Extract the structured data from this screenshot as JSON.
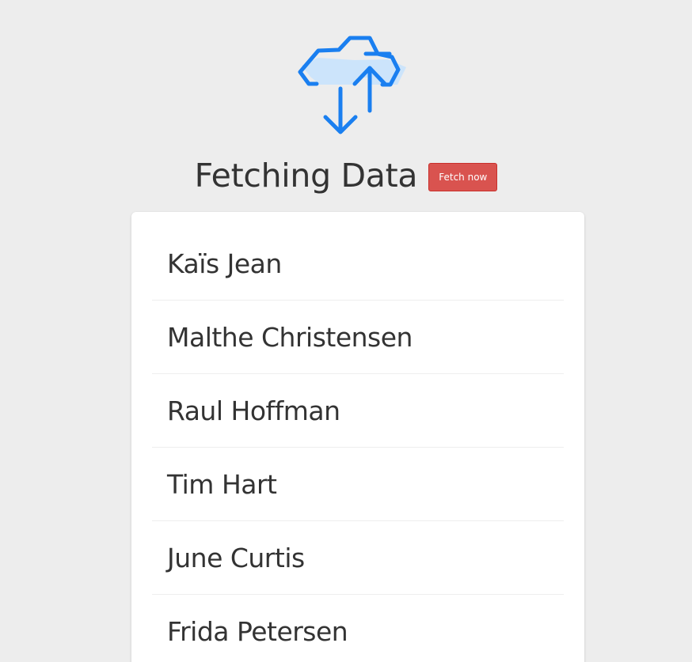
{
  "header": {
    "title": "Fetching Data",
    "fetch_button_label": "Fetch now"
  },
  "logo": {
    "icon": "cloud-sync-icon",
    "accent_color": "#1a7ff0",
    "fill_color": "#cce4fb"
  },
  "users": [
    {
      "name": "Kaïs Jean"
    },
    {
      "name": "Malthe Christensen"
    },
    {
      "name": "Raul Hoffman"
    },
    {
      "name": "Tim Hart"
    },
    {
      "name": "June Curtis"
    },
    {
      "name": "Frida Petersen"
    }
  ],
  "colors": {
    "background": "#ededed",
    "button": "#d9534f",
    "text": "#333333"
  }
}
